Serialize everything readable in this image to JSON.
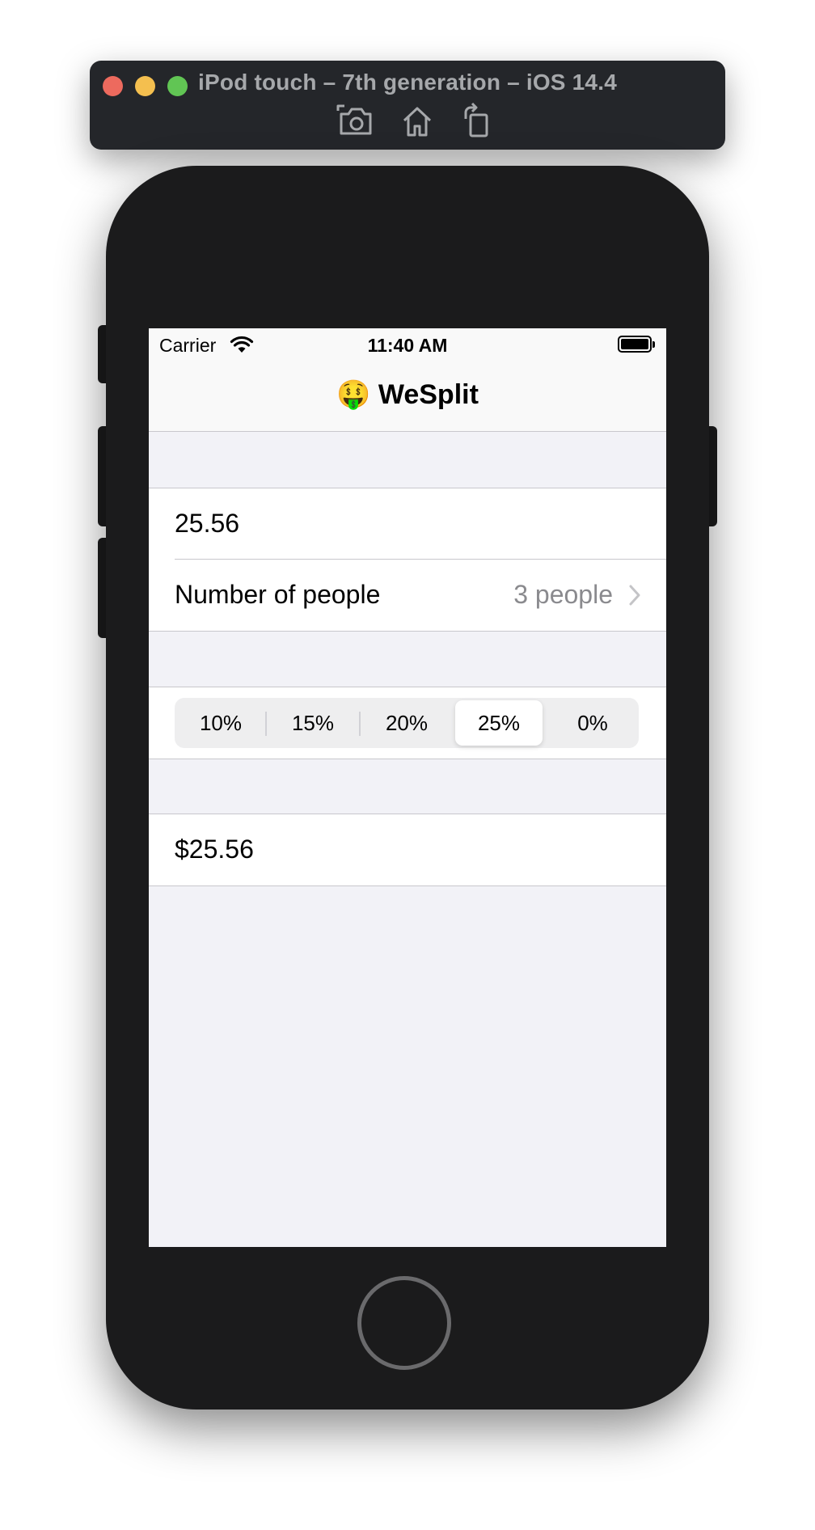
{
  "simulator": {
    "title": "iPod touch – 7th generation – iOS 14.4",
    "tools": [
      "screenshot-icon",
      "home-icon",
      "rotate-icon"
    ]
  },
  "status_bar": {
    "carrier": "Carrier",
    "time": "11:40 AM",
    "battery": 1.0
  },
  "nav": {
    "title": "🤑 WeSplit"
  },
  "form": {
    "amount_value": "25.56",
    "people_label": "Number of people",
    "people_value": "3 people",
    "tip_options": [
      "10%",
      "15%",
      "20%",
      "25%",
      "0%"
    ],
    "tip_selected_index": 3,
    "total_per_person": "$25.56"
  },
  "colors": {
    "background": "#f2f2f7",
    "separator": "#c8c7cc",
    "secondary_text": "#8a8a8e",
    "device": "#1b1b1c"
  }
}
